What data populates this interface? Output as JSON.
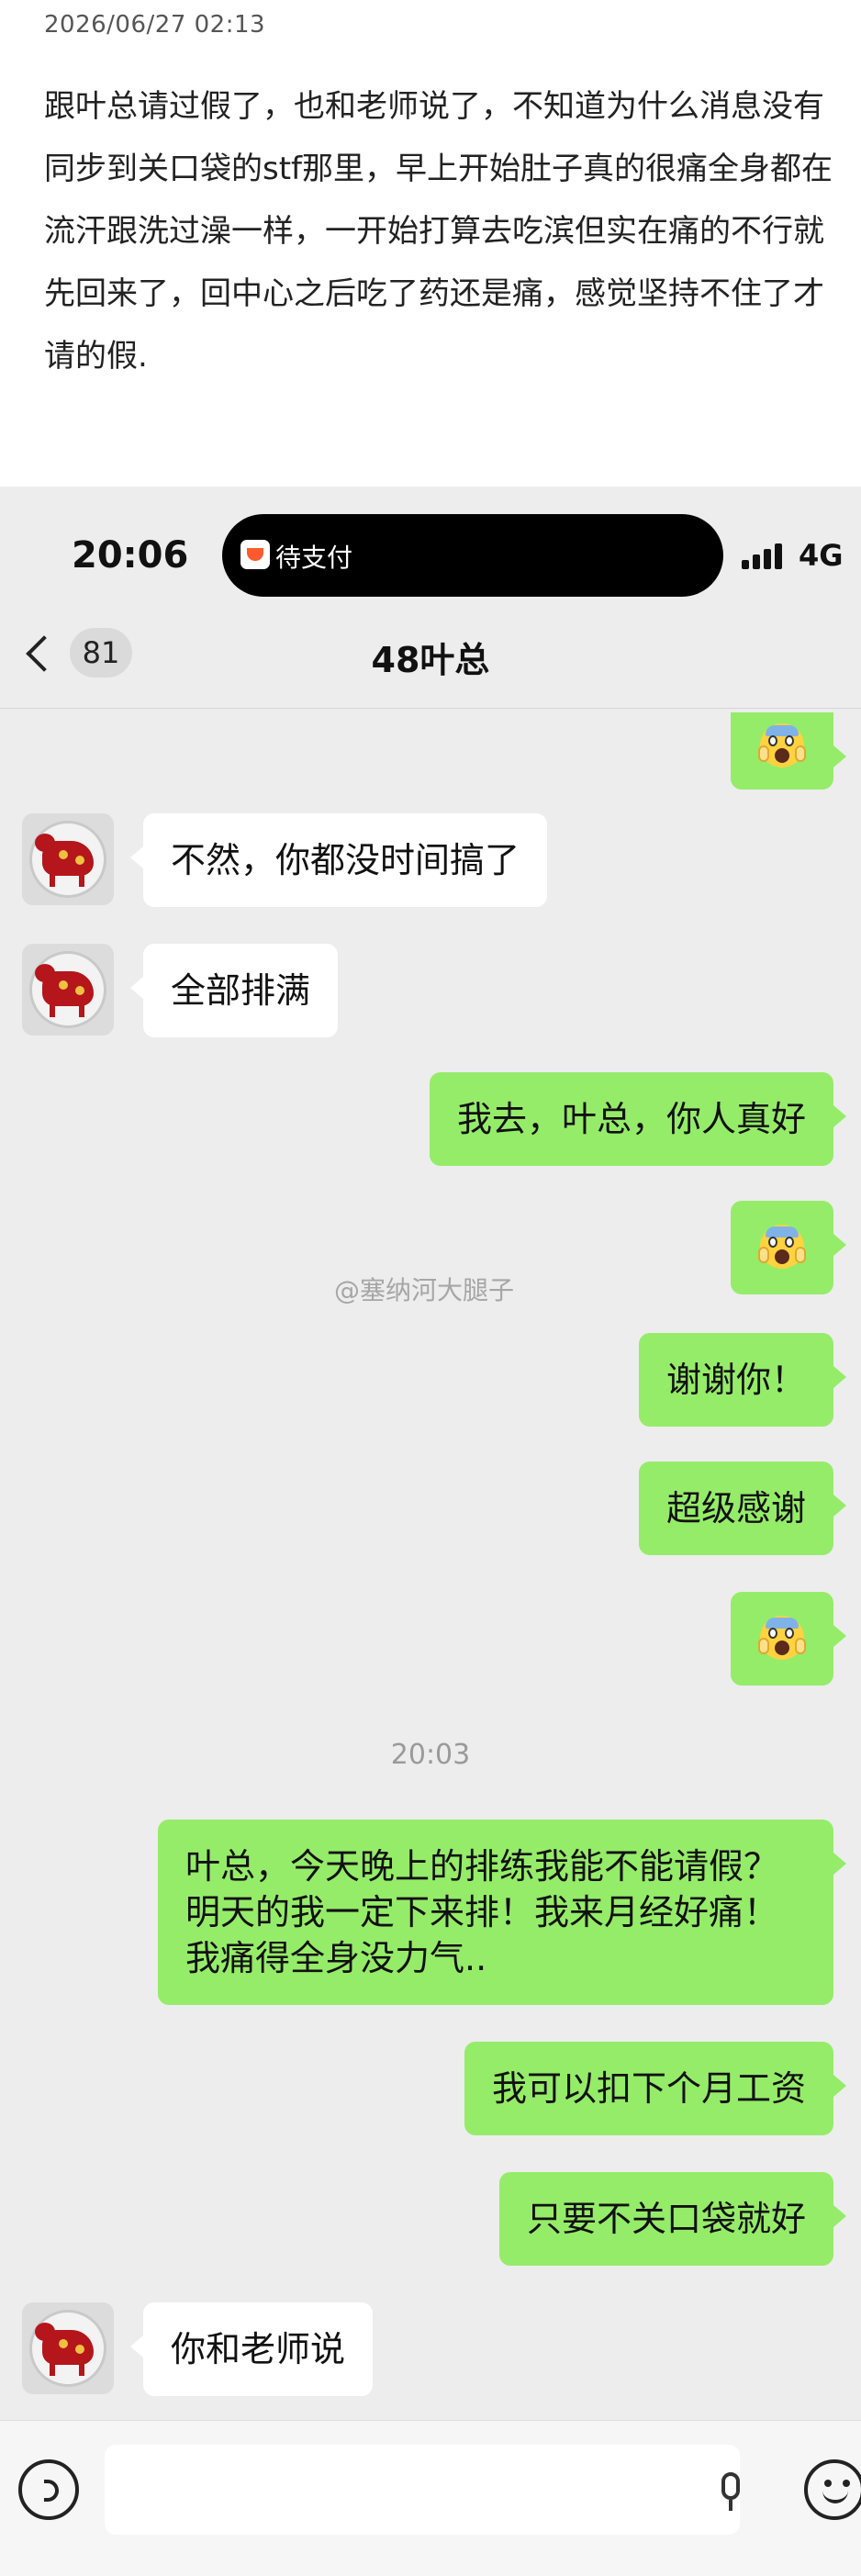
{
  "post": {
    "date": "2026/06/27 02:13",
    "body": "跟叶总请过假了，也和老师说了，不知道为什么消息没有同步到关口袋的stf那里，早上开始肚子真的很痛全身都在流汗跟洗过澡一样，一开始打算去吃滨但实在痛的不行就先回来了，回中心之后吃了药还是痛，感觉坚持不住了才请的假."
  },
  "status_bar": {
    "time": "20:06",
    "island_label": "待支付",
    "network": "4G"
  },
  "chat": {
    "title": "48叶总",
    "unread_count": "81",
    "messages": [
      {
        "id": "m0",
        "sender": "self",
        "text": "",
        "icon": "scream-emoji"
      },
      {
        "id": "m1",
        "sender": "other",
        "text": "不然，你都没时间搞了"
      },
      {
        "id": "m2",
        "sender": "other",
        "text": "全部排满"
      },
      {
        "id": "m3",
        "sender": "self",
        "text": "我去，叶总，你人真好"
      },
      {
        "id": "m4",
        "sender": "self",
        "text": "",
        "icon": "scream-emoji"
      },
      {
        "id": "m5",
        "sender": "self",
        "text": "谢谢你！"
      },
      {
        "id": "m6",
        "sender": "self",
        "text": "超级感谢"
      },
      {
        "id": "m7",
        "sender": "self",
        "text": "",
        "icon": "scream-emoji"
      },
      {
        "id": "m8",
        "sender": "self",
        "text": "叶总，今天晚上的排练我能不能请假？明天的我一定下来排！我来月经好痛！我痛得全身没力气.."
      },
      {
        "id": "m9",
        "sender": "self",
        "text": "我可以扣下个月工资"
      },
      {
        "id": "m10",
        "sender": "self",
        "text": "只要不关口袋就好"
      },
      {
        "id": "m11",
        "sender": "other",
        "text": "你和老师说"
      }
    ],
    "timestamp": "20:03",
    "watermark": "@塞纳河大腿子"
  },
  "input_bar": {
    "placeholder": ""
  },
  "colors": {
    "chat_bg": "#ededed",
    "outgoing_bubble": "#95ec69",
    "incoming_bubble": "#ffffff"
  }
}
